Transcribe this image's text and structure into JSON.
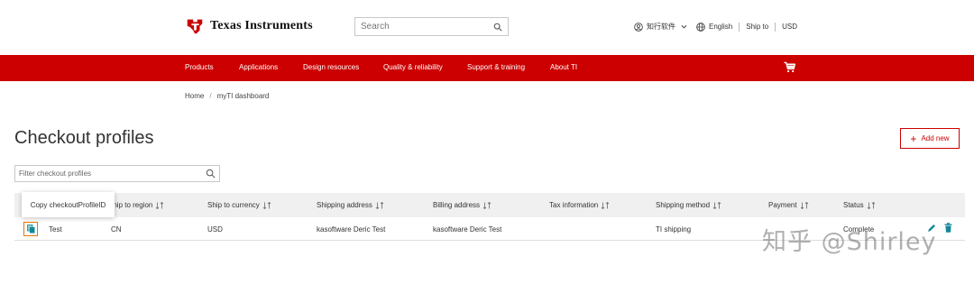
{
  "header": {
    "brand": "Texas Instruments",
    "search_placeholder": "Search",
    "account_label": "知行软件",
    "language": "English",
    "ship_to": "Ship to",
    "currency": "USD"
  },
  "nav": {
    "items": [
      "Products",
      "Applications",
      "Design resources",
      "Quality & reliability",
      "Support & training",
      "About TI"
    ]
  },
  "breadcrumb": [
    "Home",
    "myTI dashboard"
  ],
  "page": {
    "title": "Checkout profiles",
    "add_button": "Add new",
    "filter_placeholder": "Filter checkout profiles"
  },
  "table": {
    "headers": [
      "Ship to region",
      "Ship to currency",
      "Shipping address",
      "Billing address",
      "Tax information",
      "Shipping method",
      "Payment",
      "Status"
    ],
    "rows": [
      {
        "name": "Test",
        "region": "CN",
        "currency": "USD",
        "shipping_address": "kasoftware Deric Test",
        "billing_address": "kasoftware Deric Test",
        "tax_information": "",
        "shipping_method": "TI shipping",
        "payment": "",
        "status": "Complete"
      }
    ]
  },
  "tooltip": "Copy checkoutProfileID",
  "watermark": "知乎 @Shirley",
  "colors": {
    "brand_red": "#cc0000",
    "highlight_orange": "#e8740c",
    "header_row": "#f0f0f0",
    "icon_teal": "#118899"
  }
}
